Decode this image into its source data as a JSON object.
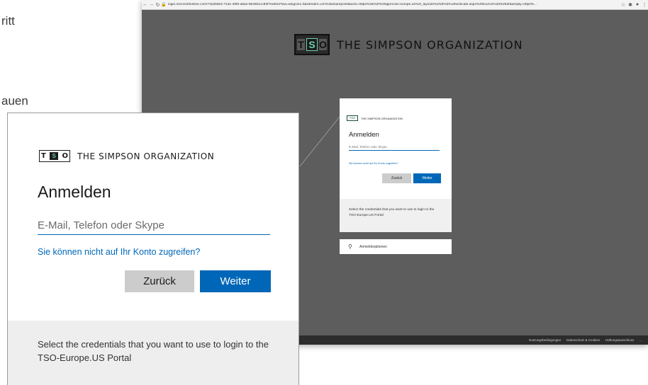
{
  "document": {
    "fragment_top": "ritt",
    "fragment_mid": "auen"
  },
  "browser": {
    "url": "login.microsoftonline.com/71b2b5b4-71d1-4f69-a5ae-8b2561cc83f7/wsfed?wa=wsignin1.0&wtrealm=urn%3asharepoint&wctx=https%3a%2f%2fagent.tso-europe.us%2f_layouts%2f15%2fAuthenticate.aspx%3fSource%3d%252f&wreply=https%...",
    "logo_mark": "TSO",
    "org_name": "THE SIMPSON ORGANIZATION",
    "footer_links": [
      "Nutzungsbedingungen",
      "Datenschutz & Cookies",
      "Haftungsausschluss",
      "..."
    ]
  },
  "mini_card": {
    "org_name": "THE SIMPSON ORGANIZATION",
    "title": "Anmelden",
    "placeholder": "E-Mail, Telefon oder Skype",
    "link": "Sie können nicht auf Ihr Konto zugreifen?",
    "back_label": "Zurück",
    "next_label": "Weiter",
    "info": "Select the credentials that you want to use to login to the TSO-Europe.US Portal",
    "options_label": "Anmeldeoptionen"
  },
  "zoom_card": {
    "logo_mark_t": "T",
    "logo_mark_s": "S",
    "logo_mark_o": "O",
    "org_name": "THE SIMPSON ORGANIZATION",
    "title": "Anmelden",
    "placeholder": "E-Mail, Telefon oder Skype",
    "link": "Sie können nicht auf Ihr Konto zugreifen?",
    "back_label": "Zurück",
    "next_label": "Weiter",
    "info": "Select the credentials that you want to use to login to the TSO-Europe.US Portal"
  },
  "colors": {
    "accent_blue": "#0067b8",
    "button_gray": "#cccccc",
    "logo_green": "#67c7a6",
    "browser_bg": "#5d5d5d"
  }
}
